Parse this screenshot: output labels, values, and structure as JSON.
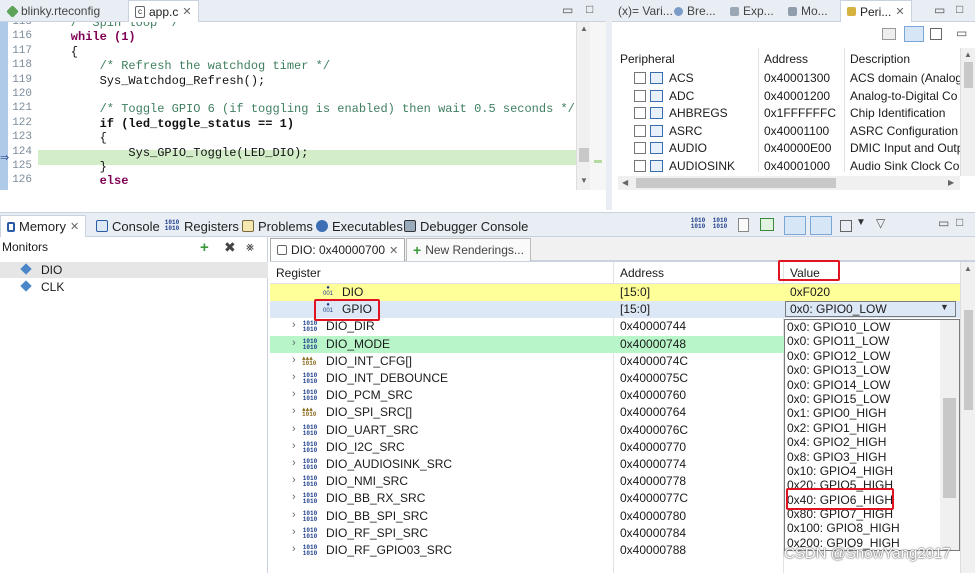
{
  "editor": {
    "tabs": [
      {
        "label": "blinky.rteconfig"
      },
      {
        "label": "app.c"
      }
    ],
    "lines": [
      {
        "n": "115",
        "t": "    /* Spin loop */",
        "k": "cm"
      },
      {
        "n": "116",
        "t": "    while (1)",
        "k": "kw"
      },
      {
        "n": "117",
        "t": "    {",
        "k": ""
      },
      {
        "n": "118",
        "t": "        /* Refresh the watchdog timer */",
        "k": "cm"
      },
      {
        "n": "119",
        "t": "        Sys_Watchdog_Refresh();",
        "k": ""
      },
      {
        "n": "120",
        "t": "",
        "k": ""
      },
      {
        "n": "121",
        "t": "        /* Toggle GPIO 6 (if toggling is enabled) then wait 0.5 seconds */",
        "k": "cm"
      },
      {
        "n": "122",
        "t": "        if (led_toggle_status == 1)",
        "k": "if"
      },
      {
        "n": "123",
        "t": "        {",
        "k": ""
      },
      {
        "n": "124",
        "t": "            Sys_GPIO_Toggle(LED_DIO);",
        "k": "hl"
      },
      {
        "n": "125",
        "t": "        }",
        "k": ""
      },
      {
        "n": "126",
        "t": "        else",
        "k": "kw"
      }
    ]
  },
  "right_panel": {
    "tabs": [
      "(x)= Vari...",
      "Bre...",
      "Exp...",
      "Mo...",
      "Peri..."
    ],
    "columns": [
      "Peripheral",
      "Address",
      "Description"
    ],
    "rows": [
      {
        "name": "ACS",
        "address": "0x40001300",
        "desc": "ACS domain (Analog"
      },
      {
        "name": "ADC",
        "address": "0x40001200",
        "desc": "Analog-to-Digital Co"
      },
      {
        "name": "AHBREGS",
        "address": "0x1FFFFFFC",
        "desc": "Chip Identification"
      },
      {
        "name": "ASRC",
        "address": "0x40001100",
        "desc": "ASRC Configuration a"
      },
      {
        "name": "AUDIO",
        "address": "0x40000E00",
        "desc": "DMIC Input and Outp"
      },
      {
        "name": "AUDIOSINK",
        "address": "0x40001000",
        "desc": "Audio Sink Clock Cou"
      }
    ]
  },
  "bottom_tabs": [
    "Memory",
    "Console",
    "Registers",
    "Problems",
    "Executables",
    "Debugger Console"
  ],
  "monitors": {
    "title": "Monitors",
    "items": [
      "DIO",
      "CLK"
    ]
  },
  "rendering": {
    "tabs": [
      "DIO: 0x40000700",
      "New Renderings..."
    ],
    "columns": [
      "Register",
      "Address",
      "Value"
    ],
    "rows": [
      {
        "name": "DIO",
        "address": "[15:0]",
        "value": "0xF020",
        "style": "yellow",
        "icon": "field",
        "indent": 2
      },
      {
        "name": "GPIO",
        "address": "[15:0]",
        "value": "0x0: GPIO0_LOW",
        "style": "blue",
        "icon": "field",
        "indent": 2
      },
      {
        "name": "DIO_DIR",
        "address": "0x40000744",
        "value": "",
        "style": "",
        "icon": "reg",
        "indent": 1
      },
      {
        "name": "DIO_MODE",
        "address": "0x40000748",
        "value": "",
        "style": "green",
        "icon": "reg",
        "indent": 1
      },
      {
        "name": "DIO_INT_CFG[]",
        "address": "0x4000074C",
        "value": "",
        "style": "",
        "icon": "arr",
        "indent": 1
      },
      {
        "name": "DIO_INT_DEBOUNCE",
        "address": "0x4000075C",
        "value": "",
        "style": "",
        "icon": "reg",
        "indent": 1
      },
      {
        "name": "DIO_PCM_SRC",
        "address": "0x40000760",
        "value": "",
        "style": "",
        "icon": "reg",
        "indent": 1
      },
      {
        "name": "DIO_SPI_SRC[]",
        "address": "0x40000764",
        "value": "",
        "style": "",
        "icon": "arr",
        "indent": 1
      },
      {
        "name": "DIO_UART_SRC",
        "address": "0x4000076C",
        "value": "",
        "style": "",
        "icon": "reg",
        "indent": 1
      },
      {
        "name": "DIO_I2C_SRC",
        "address": "0x40000770",
        "value": "",
        "style": "",
        "icon": "reg",
        "indent": 1
      },
      {
        "name": "DIO_AUDIOSINK_SRC",
        "address": "0x40000774",
        "value": "",
        "style": "",
        "icon": "reg",
        "indent": 1
      },
      {
        "name": "DIO_NMI_SRC",
        "address": "0x40000778",
        "value": "",
        "style": "",
        "icon": "reg",
        "indent": 1
      },
      {
        "name": "DIO_BB_RX_SRC",
        "address": "0x4000077C",
        "value": "",
        "style": "",
        "icon": "reg",
        "indent": 1
      },
      {
        "name": "DIO_BB_SPI_SRC",
        "address": "0x40000780",
        "value": "",
        "style": "",
        "icon": "reg",
        "indent": 1
      },
      {
        "name": "DIO_RF_SPI_SRC",
        "address": "0x40000784",
        "value": "",
        "style": "",
        "icon": "reg",
        "indent": 1
      },
      {
        "name": "DIO_RF_GPIO03_SRC",
        "address": "0x40000788",
        "value": "",
        "style": "",
        "icon": "reg",
        "indent": 1
      }
    ],
    "dropdown_options": [
      "0x0: GPIO10_LOW",
      "0x0: GPIO11_LOW",
      "0x0: GPIO12_LOW",
      "0x0: GPIO13_LOW",
      "0x0: GPIO14_LOW",
      "0x0: GPIO15_LOW",
      "0x1: GPIO0_HIGH",
      "0x2: GPIO1_HIGH",
      "0x4: GPIO2_HIGH",
      "0x8: GPIO3_HIGH",
      "0x10: GPIO4_HIGH",
      "0x20: GPIO5_HIGH",
      "0x40: GPIO6_HIGH",
      "0x80: GPIO7_HIGH",
      "0x100: GPIO8_HIGH",
      "0x200: GPIO9_HIGH"
    ],
    "dropdown_highlight_index": 12
  },
  "watermark": "CSDN @SnowYang2017",
  "colors": {
    "highlight_red": "#e0141e",
    "row_yellow": "#ffff99",
    "row_blue": "#dde8f6",
    "row_green": "#b8f5c8",
    "exec_line": "#d4edc9"
  }
}
